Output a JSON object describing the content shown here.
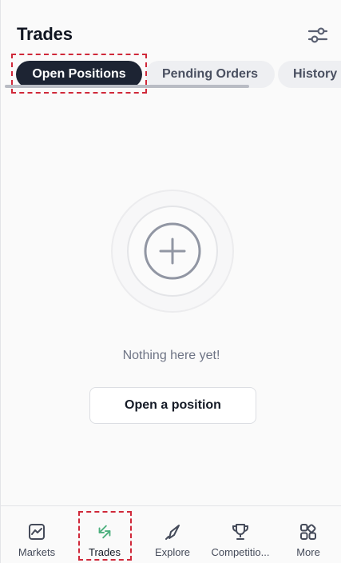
{
  "header": {
    "title": "Trades",
    "filter_icon": "sliders-icon"
  },
  "tabs": [
    {
      "label": "Open Positions",
      "active": true
    },
    {
      "label": "Pending Orders",
      "active": false
    },
    {
      "label": "History",
      "active": false
    }
  ],
  "empty_state": {
    "icon": "plus-circle-icon",
    "message": "Nothing here yet!",
    "button_label": "Open a position"
  },
  "bottom_nav": [
    {
      "label": "Markets",
      "icon": "chart-icon",
      "active": false
    },
    {
      "label": "Trades",
      "icon": "arrows-exchange-icon",
      "active": true
    },
    {
      "label": "Explore",
      "icon": "compass-icon",
      "active": false
    },
    {
      "label": "Competitio...",
      "icon": "trophy-icon",
      "active": false
    },
    {
      "label": "More",
      "icon": "grid-icon",
      "active": false
    }
  ],
  "colors": {
    "active_tab_bg": "#1d2433",
    "inactive_tab_bg": "#eeeff2",
    "trades_icon": "#4caf7d",
    "highlight": "#d0293a"
  }
}
